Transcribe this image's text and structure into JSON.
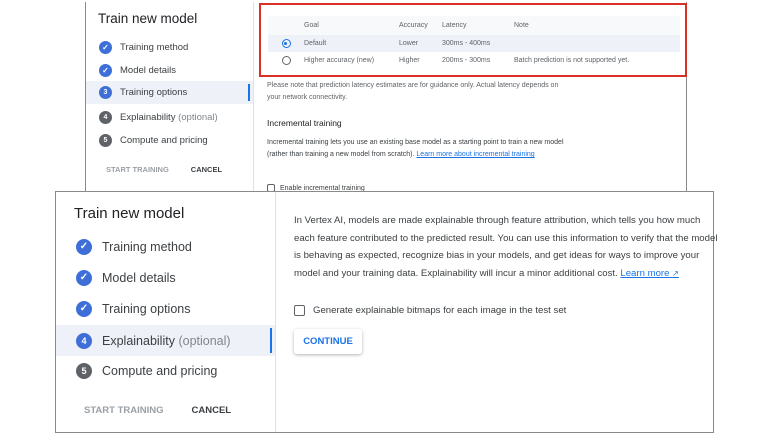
{
  "top": {
    "title": "Train new model",
    "steps": [
      {
        "label": "Training method",
        "state": "done"
      },
      {
        "label": "Model details",
        "state": "done"
      },
      {
        "label": "Training options",
        "number": "3",
        "state": "active"
      },
      {
        "label": "Explainability",
        "optional": "(optional)",
        "number": "4",
        "state": "todo"
      },
      {
        "label": "Compute and pricing",
        "number": "5",
        "state": "todo"
      }
    ],
    "start_training": "START TRAINING",
    "cancel": "CANCEL",
    "table": {
      "headers": [
        "Goal",
        "Accuracy",
        "Latency",
        "Note"
      ],
      "rows": [
        {
          "goal": "Default",
          "accuracy": "Lower",
          "latency": "300ms - 400ms",
          "note": "",
          "selected": true
        },
        {
          "goal": "Higher accuracy (new)",
          "accuracy": "Higher",
          "latency": "200ms - 300ms",
          "note": "Batch prediction is not supported yet.",
          "selected": false
        }
      ]
    },
    "latency_note": "Please note that prediction latency estimates are for guidance only. Actual latency depends on your network connectivity.",
    "incremental_heading": "Incremental training",
    "incremental_text": "Incremental training lets you use an existing base model as a starting point to train a new model (rather than training a new model from scratch).",
    "incremental_link": "Learn more about incremental training",
    "incremental_checkbox": "Enable incremental training"
  },
  "bottom": {
    "title": "Train new model",
    "steps": [
      {
        "label": "Training method",
        "state": "done"
      },
      {
        "label": "Model details",
        "state": "done"
      },
      {
        "label": "Training options",
        "state": "done"
      },
      {
        "label": "Explainability",
        "optional": "(optional)",
        "number": "4",
        "state": "active"
      },
      {
        "label": "Compute and pricing",
        "number": "5",
        "state": "todo"
      }
    ],
    "start_training": "START TRAINING",
    "cancel": "CANCEL",
    "description": "In Vertex AI, models are made explainable through feature attribution, which tells you how much each feature contributed to the predicted result. You can use this information to verify that the model is behaving as expected, recognize bias in your models, and get ideas for ways to improve your model and your training data. Explainability will incur a minor additional cost.",
    "learn_more": "Learn more",
    "checkbox_label": "Generate explainable bitmaps for each image in the test set",
    "continue": "CONTINUE"
  },
  "colors": {
    "accent": "#1a73e8",
    "highlight": "#d93025"
  }
}
